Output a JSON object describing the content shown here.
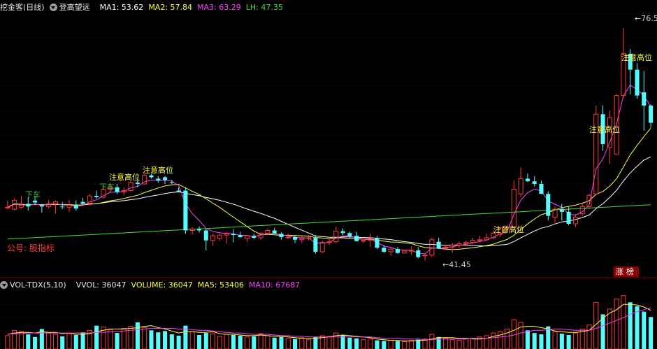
{
  "main_header": {
    "indicator_name": "挖金客(日线)",
    "formula_name": "登高望远",
    "ma1": "MA1: 53.62",
    "ma2": "MA2: 57.84",
    "ma3": "MA3: 63.29",
    "lh": "LH: 47.35"
  },
  "vol_header": {
    "name": "VOL-TDX(5,10)",
    "vvol": "VVOL: 36047",
    "volume": "VOLUME: 36047",
    "ma5": "MA5: 53406",
    "ma10": "MA10: 67687"
  },
  "account_label": "公号: 股指标",
  "rank_badge": "涨榜",
  "low_label": "41.45",
  "high_label": "76.5",
  "signals": [
    {
      "text": "下车",
      "color": "#3fbf3f"
    },
    {
      "text": "注意高位",
      "color": "#ffff3f"
    },
    {
      "text": "下车",
      "color": "#3fbf3f"
    },
    {
      "text": "注意高位",
      "color": "#ffff3f"
    },
    {
      "text": "注意高位",
      "color": "#ffff3f"
    },
    {
      "text": "注意高位",
      "color": "#ffff3f"
    },
    {
      "text": "注意高位",
      "color": "#ffff3f"
    }
  ],
  "colors": {
    "up": "#ff3b3b",
    "down": "#54fcfc",
    "ma1": "#ffffff",
    "ma2": "#ffff3f",
    "ma3": "#ff3fff",
    "lh": "#3fdf3f",
    "grid": "#7a0000",
    "tag": "#8b0000"
  },
  "chart_data": {
    "type": "candlestick",
    "price_range": [
      39,
      79
    ],
    "ma_values": {
      "MA1": 53.62,
      "MA2": 57.84,
      "MA3": 63.29,
      "LH": 47.35
    },
    "low_marker": 41.45,
    "high_marker": 76.5,
    "candles": [
      [
        49.5,
        50.5,
        49.2,
        49.5
      ],
      [
        49.2,
        50.8,
        49.0,
        50.5
      ],
      [
        49.5,
        51.2,
        49.3,
        49.8
      ],
      [
        50.0,
        51.0,
        49.0,
        49.6
      ],
      [
        50.5,
        51.2,
        49.8,
        50.2
      ],
      [
        49.8,
        50.0,
        48.7,
        49.6
      ],
      [
        49.6,
        50.6,
        49.3,
        50.0
      ],
      [
        50.0,
        50.5,
        48.5,
        50.3
      ],
      [
        49.6,
        50.3,
        49.2,
        49.5
      ],
      [
        49.5,
        50.6,
        48.8,
        49.8
      ],
      [
        49.8,
        50.5,
        49.0,
        49.3
      ],
      [
        50.3,
        50.9,
        49.8,
        50.0
      ],
      [
        50.1,
        51.5,
        49.8,
        51.2
      ],
      [
        51.2,
        52.0,
        50.8,
        51.0
      ],
      [
        51.0,
        52.5,
        50.8,
        52.2
      ],
      [
        52.2,
        53.0,
        51.6,
        52.5
      ],
      [
        52.5,
        53.0,
        51.5,
        51.8
      ],
      [
        51.8,
        52.5,
        51.3,
        52.0
      ],
      [
        52.0,
        53.5,
        51.8,
        53.2
      ],
      [
        53.2,
        54.0,
        52.5,
        53.0
      ],
      [
        53.0,
        54.5,
        52.9,
        54.3
      ],
      [
        54.3,
        54.5,
        53.8,
        54.0
      ],
      [
        53.8,
        54.2,
        53.2,
        53.5
      ],
      [
        54.0,
        54.2,
        53.0,
        53.6
      ],
      [
        53.3,
        53.6,
        53.0,
        53.2
      ],
      [
        52.0,
        52.5,
        51.8,
        51.8
      ],
      [
        52.0,
        52.5,
        45.5,
        46.0
      ],
      [
        46.0,
        46.5,
        45.4,
        46.2
      ],
      [
        46.2,
        46.6,
        45.7,
        46.0
      ],
      [
        46.0,
        46.2,
        43.0,
        44.5
      ],
      [
        44.5,
        45.5,
        43.7,
        45.2
      ],
      [
        44.8,
        45.5,
        44.5,
        45.3
      ],
      [
        45.3,
        45.8,
        44.0,
        45.5
      ],
      [
        45.5,
        46.2,
        44.2,
        45.3
      ],
      [
        45.3,
        45.8,
        44.9,
        45.0
      ],
      [
        44.8,
        45.2,
        44.3,
        45.2
      ],
      [
        45.2,
        45.5,
        44.7,
        44.9
      ],
      [
        44.9,
        45.6,
        44.6,
        45.6
      ],
      [
        45.6,
        46.3,
        45.3,
        46.0
      ],
      [
        46.0,
        46.4,
        45.6,
        45.5
      ],
      [
        45.5,
        45.7,
        44.6,
        45.0
      ],
      [
        45.0,
        45.5,
        44.7,
        45.0
      ],
      [
        45.0,
        45.3,
        44.1,
        44.6
      ],
      [
        44.6,
        45.1,
        44.1,
        44.8
      ],
      [
        44.8,
        45.3,
        44.5,
        44.9
      ],
      [
        44.9,
        45.3,
        42.5,
        42.8
      ],
      [
        42.8,
        44.5,
        42.6,
        44.2
      ],
      [
        44.2,
        45.0,
        43.8,
        44.3
      ],
      [
        44.3,
        46.6,
        44.1,
        45.9
      ],
      [
        45.9,
        46.3,
        45.3,
        45.6
      ],
      [
        45.6,
        45.8,
        44.8,
        45.2
      ],
      [
        45.2,
        45.8,
        44.3,
        44.4
      ],
      [
        44.4,
        44.8,
        44.1,
        44.5
      ],
      [
        44.5,
        45.5,
        43.5,
        44.8
      ],
      [
        44.8,
        45.2,
        43.2,
        43.4
      ],
      [
        43.4,
        43.8,
        42.6,
        42.8
      ],
      [
        42.8,
        43.4,
        42.2,
        43.2
      ],
      [
        43.2,
        43.5,
        42.5,
        42.6
      ],
      [
        42.6,
        43.0,
        42.6,
        42.9
      ],
      [
        42.9,
        43.6,
        42.3,
        43.0
      ],
      [
        43.0,
        43.5,
        41.8,
        42.0
      ],
      [
        42.2,
        42.5,
        41.45,
        42.3
      ],
      [
        42.3,
        44.9,
        42.0,
        44.6
      ],
      [
        44.3,
        44.9,
        43.2,
        43.3
      ],
      [
        43.3,
        43.9,
        43.0,
        43.5
      ],
      [
        43.5,
        44.1,
        42.6,
        43.8
      ],
      [
        43.8,
        44.3,
        43.3,
        44.0
      ],
      [
        44.0,
        44.5,
        43.6,
        44.2
      ],
      [
        44.2,
        44.9,
        44.0,
        44.5
      ],
      [
        44.5,
        45.2,
        44.2,
        44.6
      ],
      [
        44.6,
        45.5,
        44.4,
        44.9
      ],
      [
        44.9,
        46.0,
        44.7,
        45.6
      ],
      [
        45.4,
        46.5,
        45.0,
        46.3
      ],
      [
        46.3,
        46.8,
        45.8,
        46.4
      ],
      [
        46.4,
        53.5,
        46.4,
        52.2
      ],
      [
        51.5,
        55.5,
        51.0,
        53.8
      ],
      [
        53.8,
        54.6,
        53.3,
        53.4
      ],
      [
        53.4,
        54.2,
        52.6,
        53.0
      ],
      [
        53.0,
        53.5,
        52.0,
        51.5
      ],
      [
        51.5,
        51.9,
        47.5,
        48.2
      ],
      [
        48.0,
        49.6,
        46.9,
        49.2
      ],
      [
        49.2,
        50.0,
        47.5,
        48.8
      ],
      [
        48.8,
        49.5,
        46.8,
        47.0
      ],
      [
        47.0,
        48.5,
        46.5,
        48.0
      ],
      [
        48.5,
        50.0,
        48.2,
        49.6
      ],
      [
        49.6,
        51.5,
        49.2,
        51.3
      ],
      [
        51.5,
        64.8,
        51.4,
        63.5
      ],
      [
        63.5,
        64.8,
        58.0,
        59.0
      ],
      [
        58.5,
        64.0,
        56.0,
        63.0
      ],
      [
        57.5,
        66.5,
        57.5,
        66.3
      ],
      [
        66.3,
        76.5,
        66.0,
        72.6
      ],
      [
        72.6,
        73.3,
        66.5,
        70.2
      ],
      [
        70.2,
        71.2,
        65.8,
        66.3
      ],
      [
        66.8,
        70.0,
        61.0,
        64.8
      ],
      [
        64.8,
        65.0,
        61.5,
        62.2
      ]
    ],
    "volume": [
      20,
      28,
      26,
      22,
      18,
      30,
      24,
      22,
      19,
      23,
      21,
      25,
      28,
      35,
      33,
      29,
      24,
      31,
      34,
      40,
      32,
      28,
      25,
      27,
      22,
      20,
      35,
      26,
      21,
      24,
      23,
      19,
      22,
      21,
      20,
      18,
      19,
      23,
      20,
      17,
      18,
      16,
      15,
      17,
      14,
      18,
      20,
      19,
      24,
      21,
      17,
      16,
      14,
      15,
      13,
      12,
      13,
      12,
      11,
      13,
      14,
      15,
      22,
      18,
      16,
      14,
      13,
      15,
      16,
      18,
      20,
      24,
      26,
      30,
      44,
      40,
      28,
      24,
      22,
      34,
      26,
      23,
      21,
      24,
      30,
      36,
      70,
      52,
      60,
      75,
      80,
      70,
      64,
      56,
      48
    ],
    "vol_ma5": [
      22,
      24,
      25,
      25,
      24,
      26,
      25,
      25,
      23,
      24,
      22,
      22,
      23,
      26,
      28,
      30,
      30,
      30,
      31,
      32,
      34,
      35,
      32,
      30,
      27,
      24,
      26,
      26,
      25,
      25,
      26,
      23,
      22,
      22,
      21,
      20,
      20,
      21,
      20,
      19,
      19,
      18,
      17,
      16,
      16,
      16,
      17,
      18,
      20,
      21,
      20,
      19,
      18,
      17,
      15,
      14,
      13,
      13,
      12,
      12,
      13,
      13,
      15,
      17,
      17,
      17,
      16,
      16,
      15,
      15,
      16,
      19,
      21,
      24,
      28,
      33,
      34,
      34,
      32,
      30,
      27,
      26,
      25,
      25,
      26,
      28,
      37,
      46,
      54,
      59,
      67,
      67,
      66,
      63,
      58
    ],
    "vol_ma10": [
      22,
      23,
      23,
      24,
      24,
      24,
      24,
      24,
      24,
      24,
      24,
      24,
      24,
      25,
      25,
      26,
      26,
      27,
      28,
      29,
      30,
      31,
      31,
      31,
      31,
      30,
      30,
      29,
      28,
      28,
      27,
      26,
      25,
      24,
      24,
      23,
      22,
      22,
      22,
      21,
      20,
      20,
      19,
      19,
      18,
      18,
      18,
      18,
      18,
      18,
      18,
      18,
      18,
      18,
      17,
      16,
      16,
      16,
      15,
      15,
      15,
      14,
      14,
      15,
      15,
      15,
      15,
      15,
      16,
      16,
      16,
      17,
      18,
      19,
      21,
      24,
      26,
      28,
      28,
      29,
      30,
      30,
      29,
      28,
      28,
      28,
      31,
      35,
      39,
      43,
      47,
      52,
      56,
      59,
      62
    ]
  }
}
